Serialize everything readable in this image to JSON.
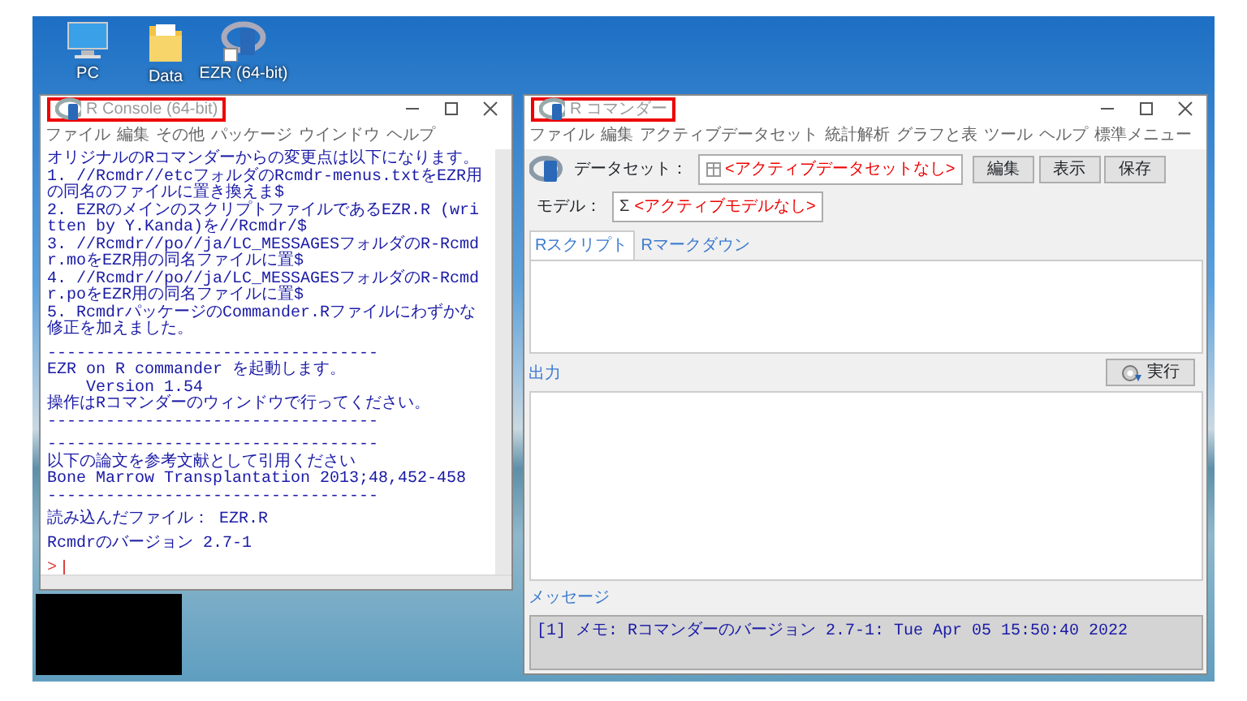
{
  "desktop": {
    "icons": [
      {
        "label": "PC",
        "kind": "pc"
      },
      {
        "label": "Data",
        "kind": "folder"
      },
      {
        "label": "EZR (64-bit)",
        "kind": "logo"
      }
    ]
  },
  "console": {
    "title": "R Console (64-bit)",
    "highlighted": true,
    "menu": [
      "ファイル",
      "編集",
      "その他",
      "パッケージ",
      "ウインドウ",
      "ヘルプ"
    ],
    "lines": [
      {
        "kind": "out",
        "text": "オリジナルのRコマンダーからの変更点は以下になります。"
      },
      {
        "kind": "out",
        "text": "1. //Rcmdr//etcフォルダのRcmdr-menus.txtをEZR用の同名のファイルに置き換えま$"
      },
      {
        "kind": "out",
        "text": "2. EZRのメインのスクリプトファイルであるEZR.R (written by Y.Kanda)を//Rcmdr/$"
      },
      {
        "kind": "out",
        "text": "3. //Rcmdr//po//ja/LC_MESSAGESフォルダのR-Rcmdr.moをEZR用の同名ファイルに置$"
      },
      {
        "kind": "out",
        "text": "4. //Rcmdr//po//ja/LC_MESSAGESフォルダのR-Rcmdr.poをEZR用の同名ファイルに置$"
      },
      {
        "kind": "out",
        "text": "5. RcmdrパッケージのCommander.Rファイルにわずかな修正を加えました。"
      },
      {
        "kind": "blank"
      },
      {
        "kind": "out",
        "text": "----------------------------------"
      },
      {
        "kind": "out",
        "text": "EZR on R commander を起動します。"
      },
      {
        "kind": "out",
        "text": "    Version 1.54"
      },
      {
        "kind": "out",
        "text": "操作はRコマンダーのウィンドウで行ってください。"
      },
      {
        "kind": "out",
        "text": "----------------------------------"
      },
      {
        "kind": "blank"
      },
      {
        "kind": "out",
        "text": "----------------------------------"
      },
      {
        "kind": "out",
        "text": "以下の論文を参考文献として引用ください"
      },
      {
        "kind": "out",
        "text": "Bone Marrow Transplantation 2013;48,452-458"
      },
      {
        "kind": "out",
        "text": "----------------------------------"
      },
      {
        "kind": "blank"
      },
      {
        "kind": "out",
        "text": "読み込んだファイル： EZR.R"
      },
      {
        "kind": "blank"
      },
      {
        "kind": "out",
        "text": "Rcmdrのバージョン 2.7-1"
      },
      {
        "kind": "blank"
      },
      {
        "kind": "prompt",
        "text": ">"
      }
    ]
  },
  "rcmdr": {
    "title": "R コマンダー",
    "highlighted": true,
    "menu": [
      "ファイル",
      "編集",
      "アクティブデータセット",
      "統計解析",
      "グラフと表",
      "ツール",
      "ヘルプ",
      "標準メニュー"
    ],
    "dataset_label": "データセット：",
    "dataset": "<アクティブデータセットなし>",
    "buttons": [
      "編集",
      "表示",
      "保存"
    ],
    "model_label": "モデル：",
    "model_symbol": "Σ",
    "model": "<アクティブモデルなし>",
    "tabs": [
      {
        "label": "Rスクリプト",
        "selected": true
      },
      {
        "label": "Rマークダウン",
        "selected": false
      }
    ],
    "output_label": "出力",
    "run_button": "実行",
    "message_label": "メッセージ",
    "messages": [
      "[1] メモ: Rコマンダーのバージョン 2.7-1: Tue Apr 05 15:50:40 2022"
    ]
  }
}
